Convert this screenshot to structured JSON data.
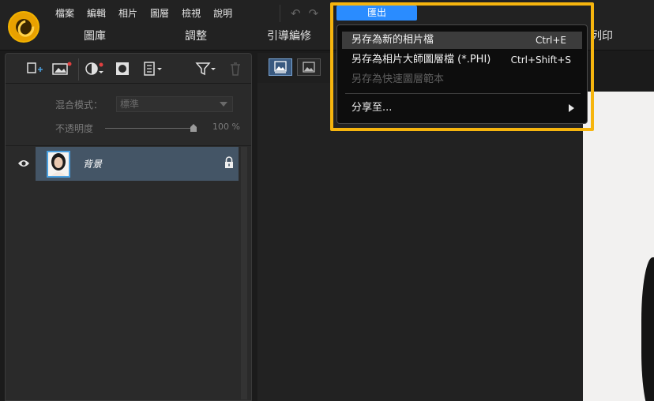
{
  "menubar": {
    "items": [
      "檔案",
      "編輯",
      "相片",
      "圖層",
      "檢視",
      "說明"
    ],
    "undo": "↶",
    "redo": "↷"
  },
  "tabs": {
    "library": "圖庫",
    "adjust": "調整",
    "guided": "引導編修",
    "print": "列印"
  },
  "export_button": {
    "label": "匯出"
  },
  "export_menu": {
    "items": [
      {
        "label": "另存為新的相片檔",
        "shortcut": "Ctrl+E",
        "state": "hover"
      },
      {
        "label": "另存為相片大師圖層檔 (*.PHI)",
        "shortcut": "Ctrl+Shift+S",
        "state": "normal"
      },
      {
        "label": "另存為快速圖層範本",
        "shortcut": "",
        "state": "disabled"
      },
      {
        "label": "分享至...",
        "shortcut": "",
        "state": "submenu"
      }
    ]
  },
  "layers_panel": {
    "blend_label": "混合模式：",
    "blend_value": "標準",
    "opacity_label": "不透明度",
    "opacity_value": "100 %",
    "opacity": 1.0,
    "layer": {
      "name": "背景",
      "visible": true,
      "locked": true
    }
  },
  "colors": {
    "accent": "#2a8cff",
    "highlight_frame": "#f6b50e",
    "selected_layer": "#445566"
  }
}
